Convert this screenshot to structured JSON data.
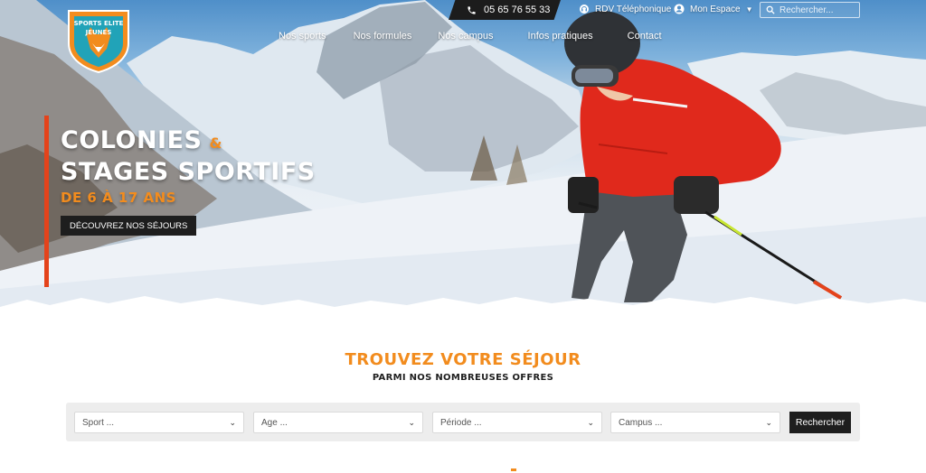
{
  "topbar": {
    "phone": "05 65 76 55 33",
    "rdv_label": "RDV Téléphonique",
    "account_label": "Mon Espace",
    "search_placeholder": "Rechercher..."
  },
  "logo": {
    "line1": "SPORTS ELITE",
    "line2": "JEUNES"
  },
  "nav": {
    "items": [
      {
        "label": "Nos sports"
      },
      {
        "label": "Nos formules"
      },
      {
        "label": "Nos campus"
      },
      {
        "label": "Infos pratiques"
      },
      {
        "label": "Contact"
      }
    ]
  },
  "hero": {
    "line1": "COLONIES",
    "amp": "&",
    "line2": "STAGES SPORTIFS",
    "line3": "DE 6 À 17 ANS",
    "cta_label": "DÉCOUVREZ NOS SÉJOURS"
  },
  "finder": {
    "title": "TROUVEZ VOTRE SÉJOUR",
    "subtitle": "PARMI NOS NOMBREUSES OFFRES",
    "selects": [
      {
        "label": "Sport ..."
      },
      {
        "label": "Age ..."
      },
      {
        "label": "Période ..."
      },
      {
        "label": "Campus ..."
      }
    ],
    "button_label": "Rechercher"
  },
  "colors": {
    "accent": "#f28c1e",
    "dark": "#1e1e1e",
    "jacket": "#e0291c"
  }
}
